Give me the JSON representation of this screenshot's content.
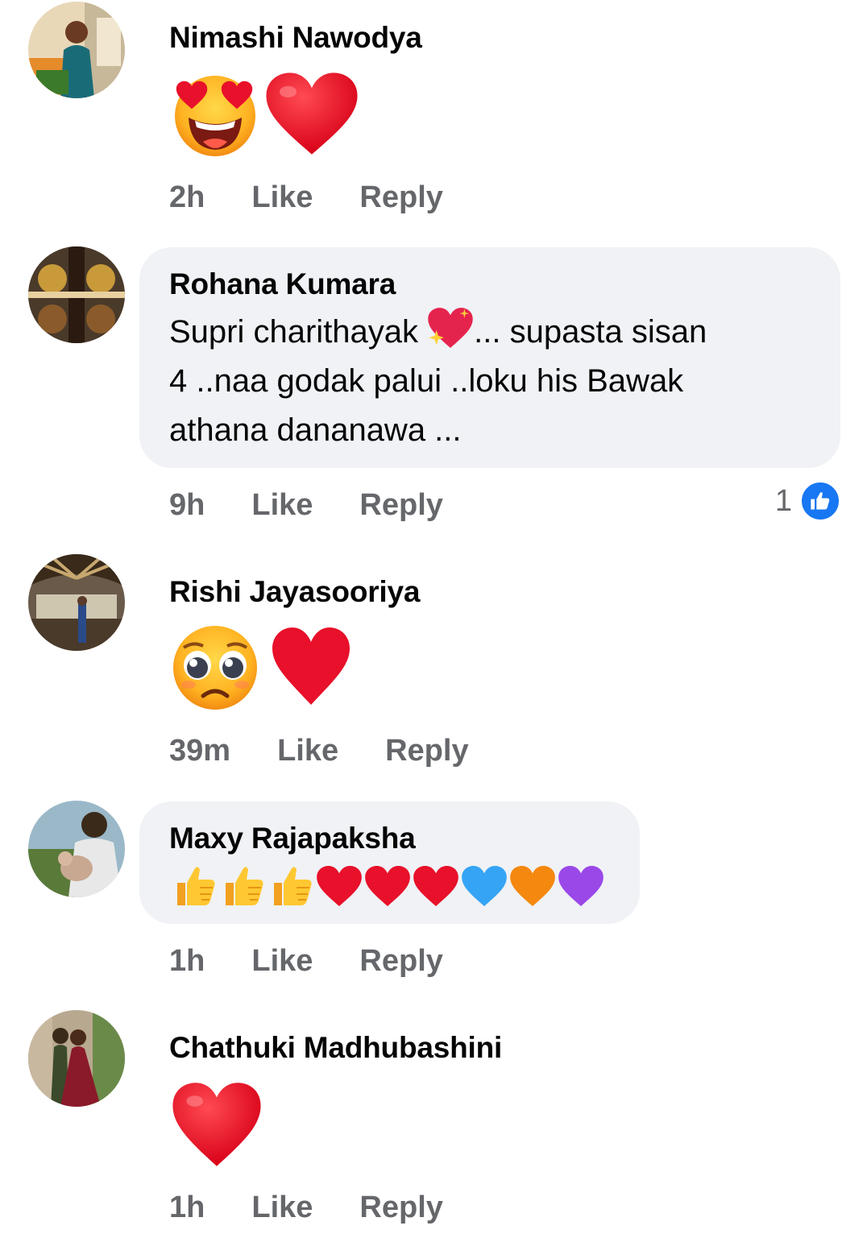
{
  "comments": [
    {
      "author": "Nimashi Nawodya",
      "emojis": [
        "heart-eyes",
        "red-heart"
      ],
      "time": "2h",
      "like_label": "Like",
      "reply_label": "Reply"
    },
    {
      "author": "Rohana Kumara",
      "text_lines": [
        "Supri charithayak",
        "... supasta sisan",
        "4 ..naa godak palui ..loku his Bawak",
        "athana dananawa ..."
      ],
      "inline_emoji": "sparkling-heart",
      "time": "9h",
      "like_label": "Like",
      "reply_label": "Reply",
      "reaction_count": "1",
      "reaction_type": "like"
    },
    {
      "author": "Rishi Jayasooriya",
      "emojis": [
        "pleading-face",
        "red-heart"
      ],
      "time": "39m",
      "like_label": "Like",
      "reply_label": "Reply"
    },
    {
      "author": "Maxy Rajapaksha",
      "emojis": [
        "thumbs-up",
        "thumbs-up",
        "thumbs-up",
        "red-heart",
        "red-heart",
        "red-heart",
        "blue-heart",
        "orange-heart",
        "purple-heart"
      ],
      "time": "1h",
      "like_label": "Like",
      "reply_label": "Reply"
    },
    {
      "author": "Chathuki Madhubashini",
      "emojis": [
        "red-heart"
      ],
      "time": "1h",
      "like_label": "Like",
      "reply_label": "Reply"
    }
  ],
  "colors": {
    "bubble": "#f0f2f5",
    "meta_text": "#65676b",
    "like_blue": "#1877f2",
    "heart_red": "#e8102a"
  }
}
